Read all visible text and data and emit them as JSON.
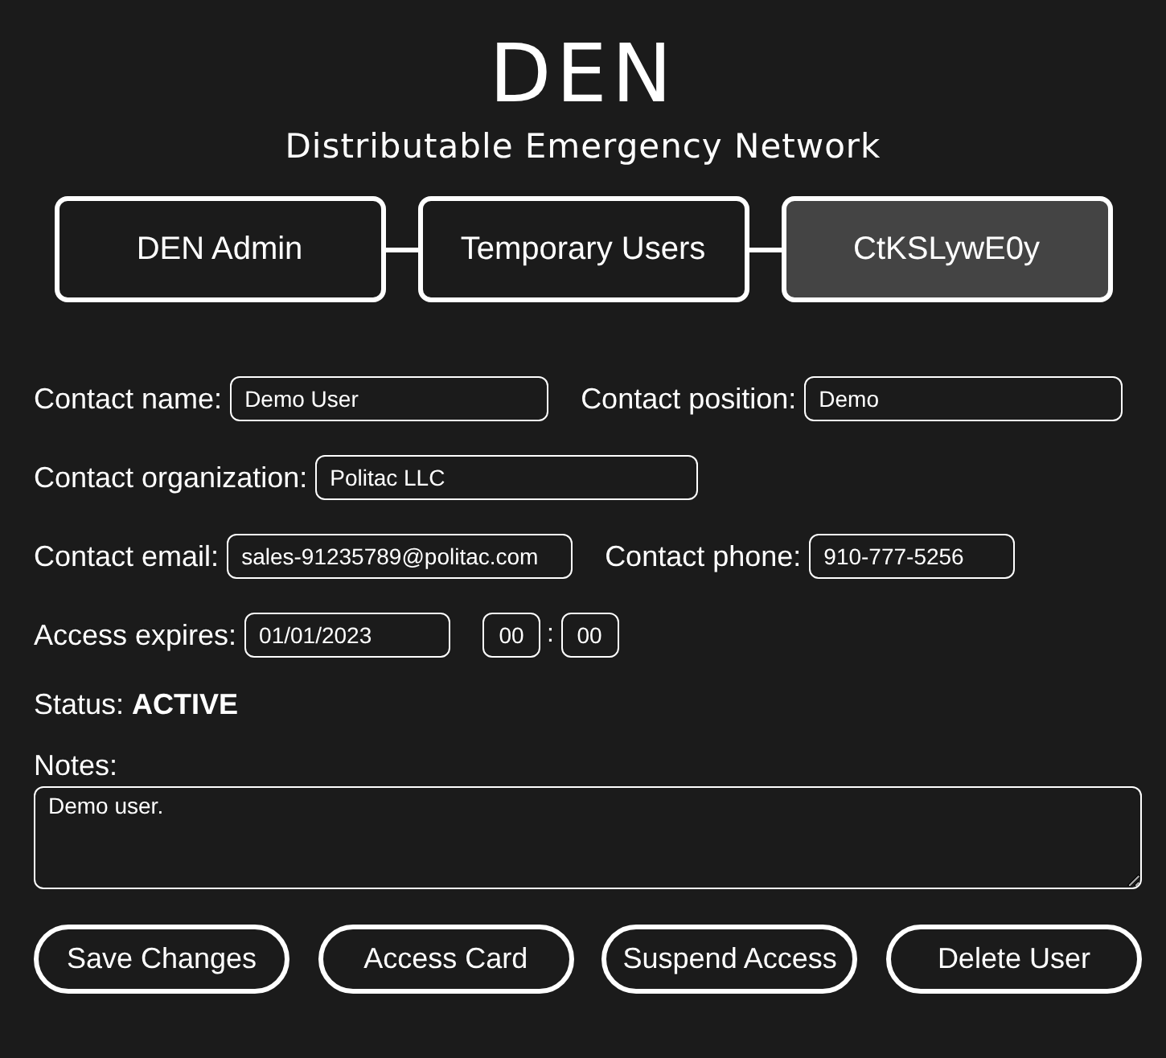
{
  "logo": {
    "title": "DEN",
    "subtitle": "Distributable Emergency Network"
  },
  "breadcrumbs": [
    {
      "label": "DEN Admin",
      "selected": false
    },
    {
      "label": "Temporary Users",
      "selected": false
    },
    {
      "label": "CtKSLywE0y",
      "selected": true
    }
  ],
  "field_rows": [
    [
      {
        "label": "Contact name:",
        "value": "Demo User",
        "kind": "name"
      },
      {
        "label": "Contact position:",
        "value": "Demo",
        "kind": "name"
      }
    ],
    [
      {
        "label": "Contact organization:",
        "value": "Politac LLC",
        "kind": "org"
      }
    ],
    [
      {
        "label": "Contact email:",
        "value": "sales-91235789@politac.com",
        "kind": "email"
      },
      {
        "label": "Contact phone:",
        "value": "910-777-5256",
        "kind": "phone"
      }
    ]
  ],
  "expiry": {
    "label": "Access expires:",
    "date": "01/01/2023",
    "hour": "00",
    "separator": ":",
    "minute": "00"
  },
  "status": "Status: **ACTIVE**",
  "notes": {
    "label": "Notes:",
    "value": "Demo user."
  },
  "buttons": [
    "Save Changes",
    "Access Card",
    "Suspend Access",
    "Delete User"
  ]
}
